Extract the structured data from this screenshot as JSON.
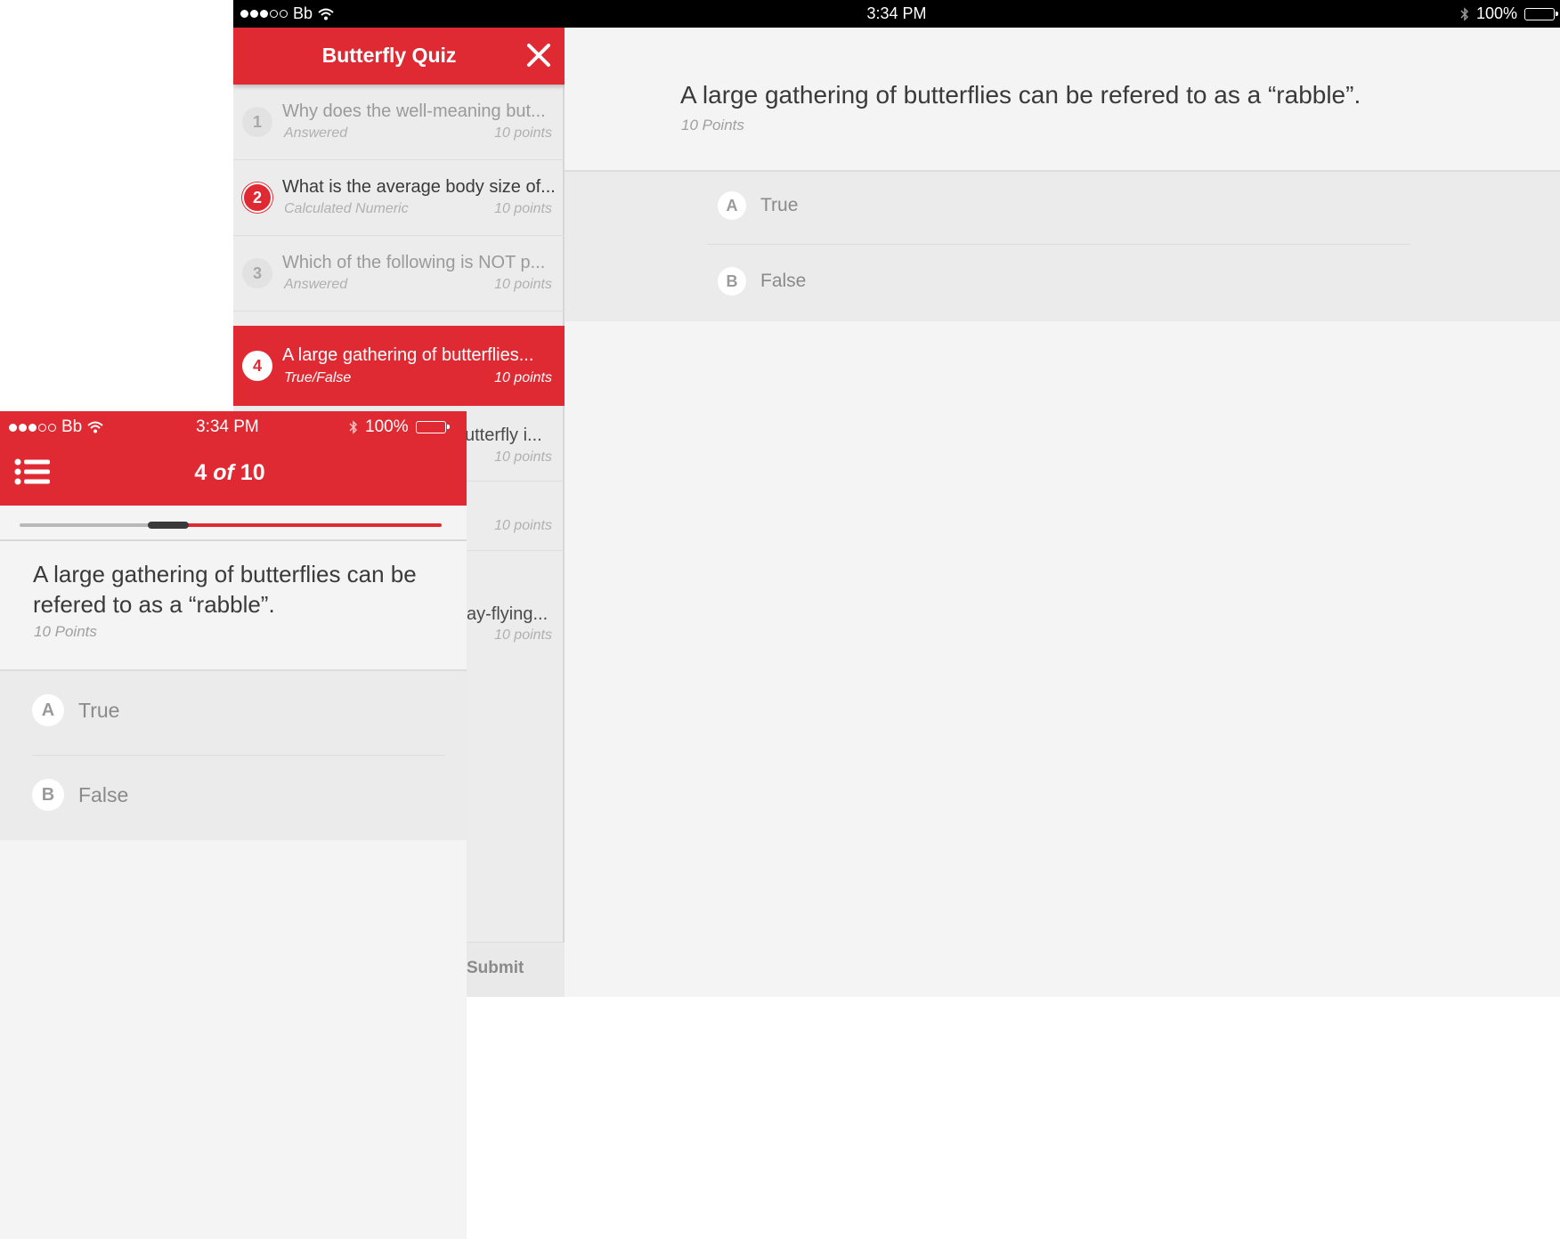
{
  "tablet": {
    "status": {
      "carrier": "Bb",
      "time": "3:34 PM",
      "battery": "100%"
    },
    "sidebar": {
      "title": "Butterfly Quiz",
      "items": [
        {
          "num": "1",
          "text": "Why does the well-meaning but...",
          "status": "Answered",
          "points": "10 points"
        },
        {
          "num": "2",
          "text": "What is the average body size of...",
          "status": "Calculated Numeric",
          "points": "10 points"
        },
        {
          "num": "3",
          "text": "Which of the following is NOT p...",
          "status": "Answered",
          "points": "10 points"
        },
        {
          "num": "4",
          "text": "A large gathering of butterflies...",
          "status": "True/False",
          "points": "10 points"
        },
        {
          "num": "",
          "text": "utterfly i...",
          "status": "",
          "points": "10 points"
        },
        {
          "num": "",
          "text": "",
          "status": "",
          "points": "10 points"
        },
        {
          "num": "",
          "text": "ay-flying...",
          "status": "",
          "points": "10 points"
        }
      ],
      "submit_label": "Submit"
    },
    "main": {
      "question": "A large gathering of butterflies can be refered to as a “rabble”.",
      "points": "10 Points",
      "answers": [
        {
          "letter": "A",
          "label": "True"
        },
        {
          "letter": "B",
          "label": "False"
        }
      ]
    }
  },
  "phone": {
    "status": {
      "carrier": "Bb",
      "time": "3:34 PM",
      "battery": "100%"
    },
    "counter": {
      "current": "4",
      "of": "of",
      "total": "10"
    },
    "progress": 0.4,
    "question": "A large gathering of butterflies can be refered to as a “rabble”.",
    "points": "10 Points",
    "answers": [
      {
        "letter": "A",
        "label": "True"
      },
      {
        "letter": "B",
        "label": "False"
      }
    ]
  },
  "colors": {
    "accent": "#e02a33",
    "background": "#f4f4f4",
    "answer_bg": "#ebebeb"
  }
}
